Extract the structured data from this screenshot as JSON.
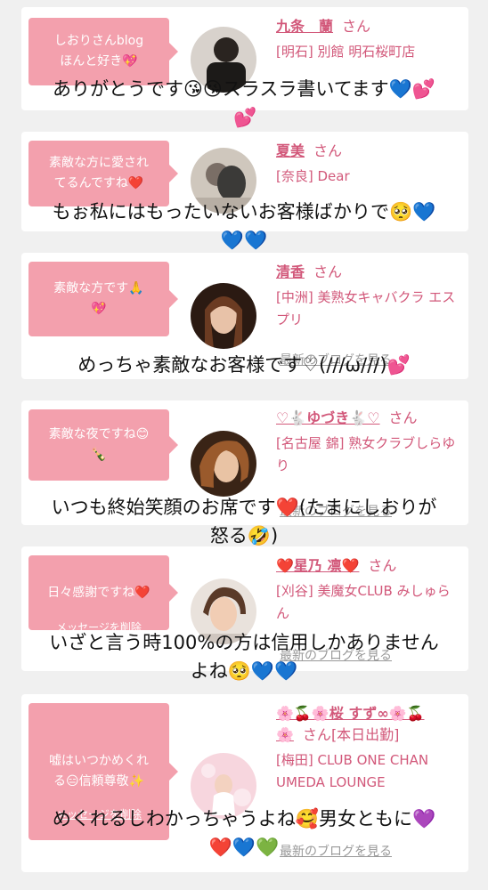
{
  "delete_label": "メッセージを削除",
  "blog_link_label": "最新のブログを見る",
  "honorific": "さん",
  "cards": [
    {
      "message": [
        "しおりさんblog",
        "ほんと好き💖"
      ],
      "name": "九条　蘭",
      "shop": "[明石] 別館 明石桜町店",
      "caption": [
        "ありがとうです😘😘スラスラ書いてます💙💕",
        "💕"
      ]
    },
    {
      "message": [
        "素敵な方に愛され",
        "てるんですね❤️"
      ],
      "name": "夏美",
      "shop": "[奈良] Dear",
      "caption": [
        "もぉ私にはもったいないお客様ばかりで🥺💙",
        "💙💙"
      ]
    },
    {
      "message": [
        "素敵な方です🙏",
        "💖"
      ],
      "name": "清香",
      "shop": "[中洲] 美熟女キャバクラ エスプリ",
      "caption": [
        "めっちゃ素敵なお客様です♡(///ω///)💕"
      ]
    },
    {
      "message": [
        "素敵な夜ですね😊",
        "🍾"
      ],
      "name": "♡🐇ゆづき🐇♡",
      "shop": "[名古屋 錦] 熟女クラブしらゆり",
      "caption": [
        "いつも終始笑顔のお席です❤️(たまにしおりが",
        "怒る🤣)"
      ]
    },
    {
      "message": [
        "日々感謝ですね❤️"
      ],
      "name": "❤️星乃 凛❤️",
      "shop": "[刈谷] 美魔女CLUB みしゅらん",
      "caption": [
        "いざと言う時100%の方は信用しかありません",
        "よね🥺💙💙"
      ]
    },
    {
      "message": [
        "嘘はいつかめくれ",
        "る😑信頼尊敬✨"
      ],
      "name": "🌸🍒🌸桜 すず∞🌸🍒",
      "name_suffix": "🌸",
      "status": "[本日出勤]",
      "shop": "[梅田] CLUB ONE CHAN UMEDA LOUNGE",
      "caption": [
        "めくれるしわかっちゃうよね🥰男女ともに💜",
        "❤️💙💚"
      ]
    }
  ]
}
